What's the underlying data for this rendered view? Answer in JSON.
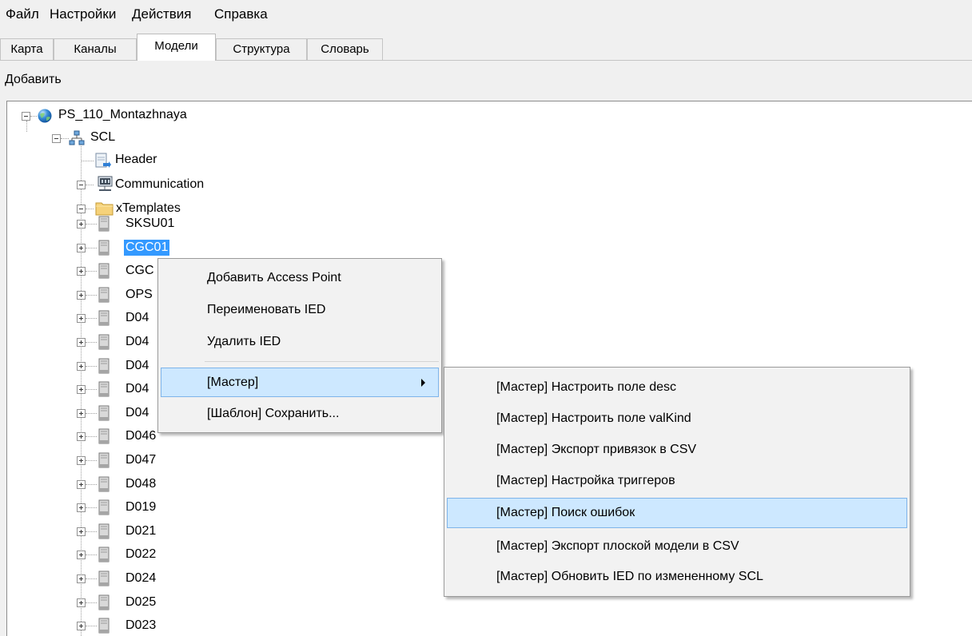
{
  "menubar": {
    "items": [
      "Файл",
      "Настройки",
      "Действия",
      "Справка"
    ]
  },
  "tabs": [
    {
      "label": "Карта",
      "active": false
    },
    {
      "label": "Каналы",
      "active": false
    },
    {
      "label": "Модели",
      "active": true
    },
    {
      "label": "Структура",
      "active": false
    },
    {
      "label": "Словарь",
      "active": false
    }
  ],
  "toolbar": {
    "add_label": "Добавить"
  },
  "tree": {
    "root": "PS_110_Montazhnaya",
    "scl": "SCL",
    "header": "Header",
    "communication": "Communication",
    "xtemplates": "xTemplates",
    "ieds": [
      "SKSU01",
      "CGC01",
      "CGC",
      "OPS",
      "D04",
      "D04",
      "D04",
      "D04",
      "D04",
      "D046",
      "D047",
      "D048",
      "D019",
      "D021",
      "D022",
      "D024",
      "D025",
      "D023"
    ],
    "selected_ied": "CGC01"
  },
  "context_menu": {
    "items": [
      "Добавить Access Point",
      "Переименовать IED",
      "Удалить IED"
    ],
    "wizard": "[Мастер]",
    "template_save": "[Шаблон] Сохранить..."
  },
  "submenu": {
    "items": [
      "[Мастер] Настроить поле desc",
      "[Мастер] Настроить поле valKind",
      "[Мастер] Экспорт привязок в CSV",
      "[Мастер] Настройка триггеров",
      "[Мастер] Поиск ошибок",
      "[Мастер] Экспорт плоской модели в CSV",
      "[Мастер] Обновить IED по измененному SCL"
    ],
    "highlighted": "[Мастер] Поиск ошибок"
  },
  "colors": {
    "selection": "#3399ff",
    "menu_highlight": "#cde8ff",
    "menu_highlight_border": "#7eb4ea"
  }
}
